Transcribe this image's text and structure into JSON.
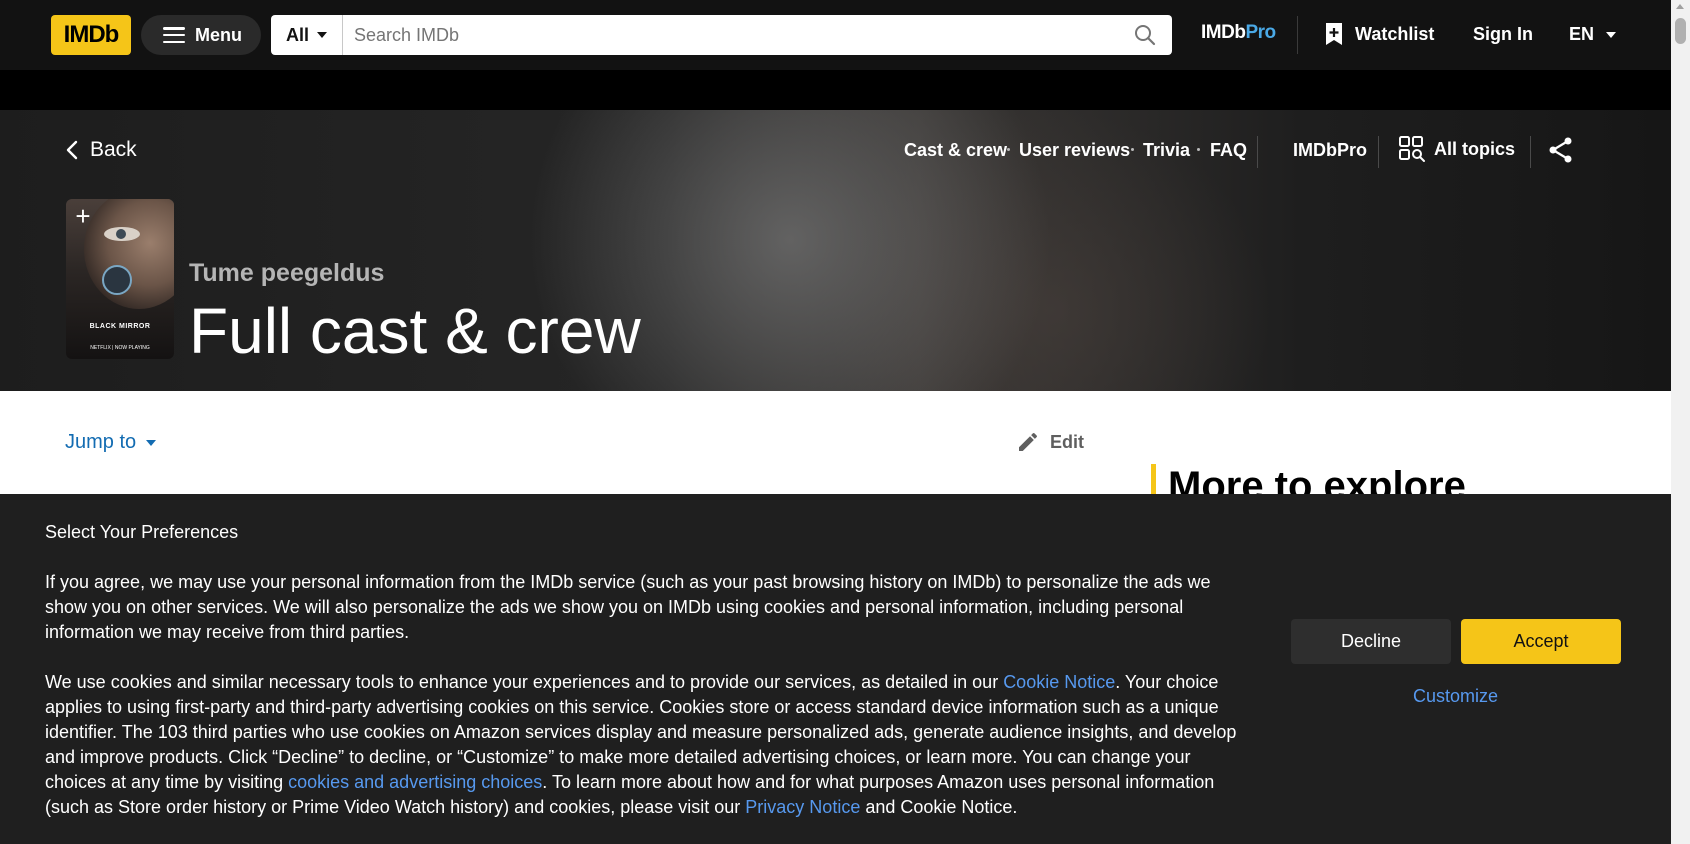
{
  "nav": {
    "logo": "IMDb",
    "menu_label": "Menu",
    "search_category": "All",
    "search_placeholder": "Search IMDb",
    "imdbpro_a": "IMDb",
    "imdbpro_b": "Pro",
    "watchlist": "Watchlist",
    "signin": "Sign In",
    "language": "EN"
  },
  "hero": {
    "back": "Back",
    "subnav": [
      "Cast & crew",
      "User reviews",
      "Trivia",
      "FAQ"
    ],
    "imdbpro": "IMDbPro",
    "all_topics": "All topics",
    "poster_title": "BLACK MIRROR",
    "poster_footer": "NETFLIX | NOW PLAYING",
    "kicker": "Tume peegeldus",
    "title": "Full cast & crew"
  },
  "content": {
    "jump_to": "Jump to",
    "edit": "Edit",
    "more_to_explore": "More to explore"
  },
  "cookie": {
    "title": "Select Your Preferences",
    "p1": "If you agree, we may use your personal information from the IMDb service (such as your past browsing history on IMDb) to personalize the ads we show you on other services. We will also personalize the ads we show you on IMDb using cookies and personal information, including personal information we may receive from third parties.",
    "p2_a": "We use cookies and similar necessary tools to enhance your experiences and to provide our services, as detailed in our ",
    "p2_link1": "Cookie Notice",
    "p2_b": ". Your choice applies to using first-party and third-party advertising cookies on this service. Cookies store or access standard device information such as a unique identifier. The 103 third parties who use cookies on Amazon services display and measure personalized ads, generate audience insights, and develop and improve products. Click “Decline” to decline, or “Customize” to make more detailed advertising choices, or learn more. You can change your choices at any time by visiting ",
    "p2_link2": "cookies and advertising choices",
    "p2_c": ". To learn more about how and for what purposes Amazon uses personal information (such as Store order history or Prime Video Watch history) and cookies, please visit our ",
    "p2_link3": "Privacy Notice",
    "p2_d": " and Cookie Notice.",
    "decline": "Decline",
    "accept": "Accept",
    "customize": "Customize"
  },
  "colors": {
    "brand_yellow": "#f5c518",
    "nav_bg": "#121212",
    "link_blue": "#5799ef",
    "jump_blue": "#136cb2",
    "imdbpro_blue": "#4aa9e6"
  }
}
